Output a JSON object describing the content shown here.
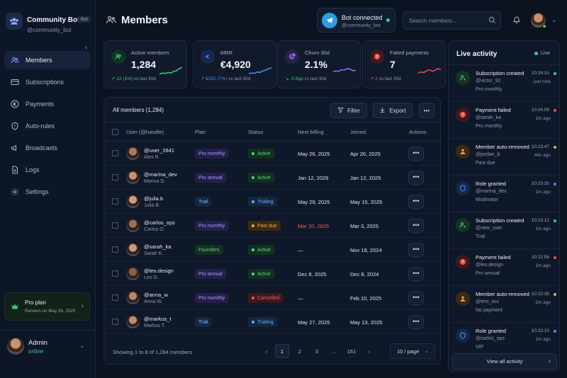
{
  "brand": {
    "name": "Community Bot",
    "tag": "Bot",
    "handle": "@community_bot"
  },
  "nav": [
    {
      "label": "Members",
      "icon": "users-icon",
      "active": true
    },
    {
      "label": "Subscriptions",
      "icon": "card-icon"
    },
    {
      "label": "Payments",
      "icon": "euro-icon"
    },
    {
      "label": "Auto-rules",
      "icon": "shield-icon"
    },
    {
      "label": "Broadcasts",
      "icon": "megaphone-icon"
    },
    {
      "label": "Logs",
      "icon": "document-icon"
    },
    {
      "label": "Settings",
      "icon": "gear-icon"
    }
  ],
  "plan": {
    "title": "Pro plan",
    "subtitle": "Renews on May 26, 2025"
  },
  "user": {
    "name": "Admin",
    "status": "online"
  },
  "header": {
    "title": "Members"
  },
  "bot": {
    "title": "Bot connected",
    "handle": "@community_bot"
  },
  "search": {
    "placeholder": "Search members..."
  },
  "stats": [
    {
      "label": "Active members",
      "value": "1,284",
      "delta": "↗ 12 (1%)",
      "suffix": "vs last 30d",
      "color": "#3ecf74",
      "icon_bg": "#153324",
      "icon": "users-icon",
      "spark": [
        0.2,
        0.3,
        0.25,
        0.35,
        0.3,
        0.45,
        0.5,
        0.7,
        0.8
      ]
    },
    {
      "label": "MRR",
      "value": "€4,920",
      "delta": "↗ €320 (7%)",
      "suffix": "vs last 30d",
      "color": "#4a8dff",
      "icon_bg": "#15274a",
      "icon": "euro-icon",
      "spark": [
        0.25,
        0.3,
        0.28,
        0.4,
        0.35,
        0.5,
        0.55,
        0.7,
        0.75
      ]
    },
    {
      "label": "Churn 30d",
      "value": "2.1%",
      "delta": "↘ -0.6pp",
      "suffix": "vs last 30d",
      "color": "#9b6cff",
      "icon_bg": "#2a2147",
      "icon": "pie-icon",
      "spark": [
        0.4,
        0.5,
        0.45,
        0.6,
        0.55,
        0.7,
        0.65,
        0.5,
        0.55
      ]
    },
    {
      "label": "Failed payments",
      "value": "7",
      "delta": "↗ 3",
      "suffix": "vs last 30d",
      "color": "#ef4b4b",
      "icon_bg": "#3a1a1f",
      "icon": "alert-icon",
      "spark": [
        0.3,
        0.4,
        0.35,
        0.5,
        0.6,
        0.45,
        0.55,
        0.7,
        0.6
      ]
    }
  ],
  "table": {
    "title": "All members (1,284)",
    "filter_label": "Filter",
    "export_label": "Export",
    "columns": {
      "user": "User (@handle)",
      "plan": "Plan",
      "status": "Status",
      "next": "Next billing",
      "joined": "Joined",
      "actions": "Actions"
    },
    "rows": [
      {
        "handle": "@user_2841",
        "name": "Alex R.",
        "plan": "Pro monthly",
        "plan_kind": "pro",
        "status": "Active",
        "status_kind": "active",
        "next": "May 26, 2025",
        "joined": "Apr 26, 2025",
        "av": "#b07a58"
      },
      {
        "handle": "@marina_dev",
        "name": "Marina D.",
        "plan": "Pro annual",
        "plan_kind": "pro",
        "status": "Active",
        "status_kind": "active",
        "next": "Jan 12, 2026",
        "joined": "Jan 12, 2025",
        "av": "#c49070"
      },
      {
        "handle": "@julia.b",
        "name": "Julia B.",
        "plan": "Trial",
        "plan_kind": "trial",
        "status": "Trialing",
        "status_kind": "trial",
        "next": "May 29, 2025",
        "joined": "May 15, 2025",
        "av": "#d09a7a"
      },
      {
        "handle": "@carlos_ops",
        "name": "Carlos O.",
        "plan": "Pro monthly",
        "plan_kind": "pro",
        "status": "Past due",
        "status_kind": "pastdue",
        "next": "Mar 20, 2025",
        "joined": "Mar 3, 2025",
        "av": "#9a7056",
        "next_red": true
      },
      {
        "handle": "@sarah_ka",
        "name": "Sarah K.",
        "plan": "Founders",
        "plan_kind": "founders",
        "status": "Active",
        "status_kind": "active",
        "next": "—",
        "joined": "Nov 18, 2024",
        "av": "#c89878"
      },
      {
        "handle": "@leo.design",
        "name": "Leo D.",
        "plan": "Pro annual",
        "plan_kind": "pro",
        "status": "Active",
        "status_kind": "active",
        "next": "Dec 8, 2025",
        "joined": "Dec 8, 2024",
        "av": "#8a5e44"
      },
      {
        "handle": "@anna_w",
        "name": "Anna W.",
        "plan": "Pro monthly",
        "plan_kind": "pro",
        "status": "Cancelled",
        "status_kind": "cancelled",
        "next": "—",
        "joined": "Feb 10, 2025",
        "av": "#b88466"
      },
      {
        "handle": "@markus_t",
        "name": "Markus T.",
        "plan": "Trial",
        "plan_kind": "trial",
        "status": "Trialing",
        "status_kind": "trial",
        "next": "May 27, 2025",
        "joined": "May 13, 2025",
        "av": "#c08c6c"
      }
    ],
    "footer": "Showing 1 to 8 of 1,284 members",
    "pages": [
      "1",
      "2",
      "3",
      "...",
      "161"
    ],
    "per_page": "10 / page"
  },
  "activity": {
    "title": "Live activity",
    "live_label": "Live",
    "view_all": "View all activity",
    "events": [
      {
        "title": "Subscription created",
        "user": "@victor_92",
        "detail": "Pro monthly",
        "time": "10:24:31",
        "rel": "just now",
        "kind": "green"
      },
      {
        "title": "Payment failed",
        "user": "@sarah_ka",
        "detail": "Pro monthly",
        "time": "10:24:09",
        "rel": "1m ago",
        "kind": "red"
      },
      {
        "title": "Member auto-removed",
        "user": "@jordan_b",
        "detail": "Past due",
        "time": "10:23:47",
        "rel": "44s ago",
        "kind": "orange"
      },
      {
        "title": "Role granted",
        "user": "@marina_dev",
        "detail": "Moderator",
        "time": "10:23:30",
        "rel": "1m ago",
        "kind": "blue"
      },
      {
        "title": "Subscription created",
        "user": "@new_user",
        "detail": "Trial",
        "time": "10:23:12",
        "rel": "1m ago",
        "kind": "green"
      },
      {
        "title": "Payment failed",
        "user": "@leo.design",
        "detail": "Pro annual",
        "time": "10:22:58",
        "rel": "1m ago",
        "kind": "red"
      },
      {
        "title": "Member auto-removed",
        "user": "@test_acc",
        "detail": "No payment",
        "time": "10:22:35",
        "rel": "2m ago",
        "kind": "orange"
      },
      {
        "title": "Role granted",
        "user": "@carlos_ops",
        "detail": "VIP",
        "time": "10:22:10",
        "rel": "1m ago",
        "kind": "blue"
      }
    ]
  }
}
